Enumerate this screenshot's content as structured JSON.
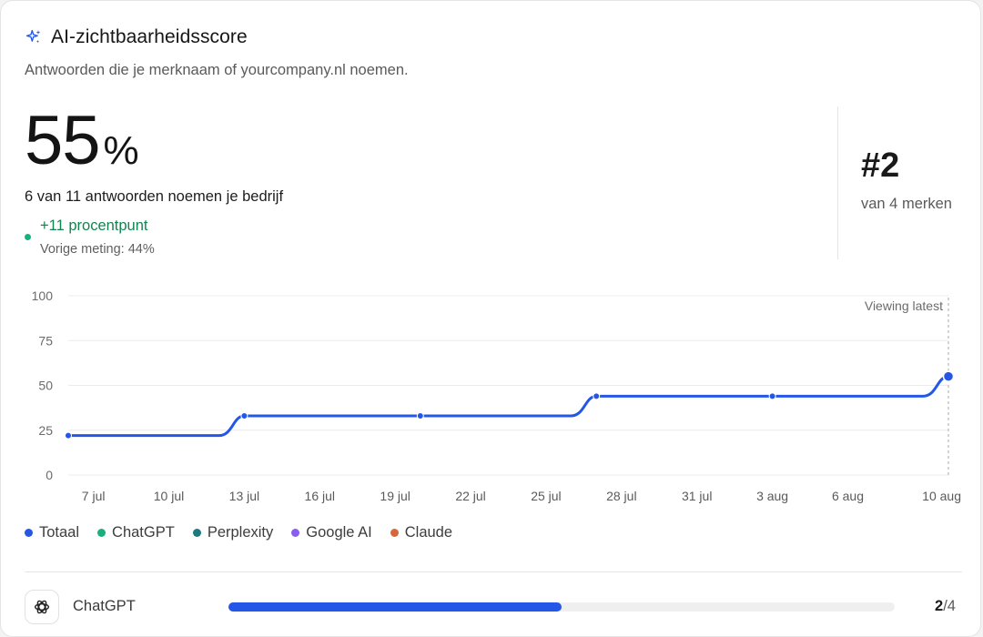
{
  "card": {
    "title": "AI-zichtbaarheidsscore",
    "subtitle": "Antwoorden die je merknaam of yourcompany.nl noemen.",
    "icon": "sparkle-icon",
    "accent_color": "#2457e6"
  },
  "score": {
    "value": "55",
    "unit": "%",
    "mentions_text": "6 van 11 antwoorden noemen je bedrijf",
    "change_text": "+11 procentpunt",
    "change_color": "#12844f",
    "previous_text": "Vorige meting: 44%"
  },
  "rank": {
    "value": "#2",
    "subtext": "van 4 merken"
  },
  "chart_data": {
    "type": "line",
    "title": "",
    "xlabel": "",
    "ylabel": "",
    "ylim": [
      0,
      100
    ],
    "y_ticks": [
      "100",
      "75",
      "50",
      "25",
      "0"
    ],
    "x_ticks": [
      "7 jul",
      "10 jul",
      "13 jul",
      "16 jul",
      "19 jul",
      "22 jul",
      "25 jul",
      "28 jul",
      "31 jul",
      "3 aug",
      "6 aug",
      "10 aug"
    ],
    "annotation": "Viewing latest",
    "grid": true,
    "series": [
      {
        "name": "Totaal",
        "color": "#2457e6",
        "points": [
          {
            "x": "6 jul",
            "y": 22
          },
          {
            "x": "13 jul",
            "y": 33
          },
          {
            "x": "20 jul",
            "y": 33
          },
          {
            "x": "27 jul",
            "y": 44
          },
          {
            "x": "3 aug",
            "y": 44
          },
          {
            "x": "10 aug",
            "y": 55
          }
        ]
      }
    ]
  },
  "legend": [
    {
      "label": "Totaal",
      "color": "#2457e6"
    },
    {
      "label": "ChatGPT",
      "color": "#19b07a"
    },
    {
      "label": "Perplexity",
      "color": "#1f7a80"
    },
    {
      "label": "Google AI",
      "color": "#8a5cf0"
    },
    {
      "label": "Claude",
      "color": "#d4683a"
    }
  ],
  "engines": [
    {
      "name": "ChatGPT",
      "icon": "chatgpt-icon",
      "value": "2",
      "total": "/4",
      "fraction": 0.5
    }
  ]
}
